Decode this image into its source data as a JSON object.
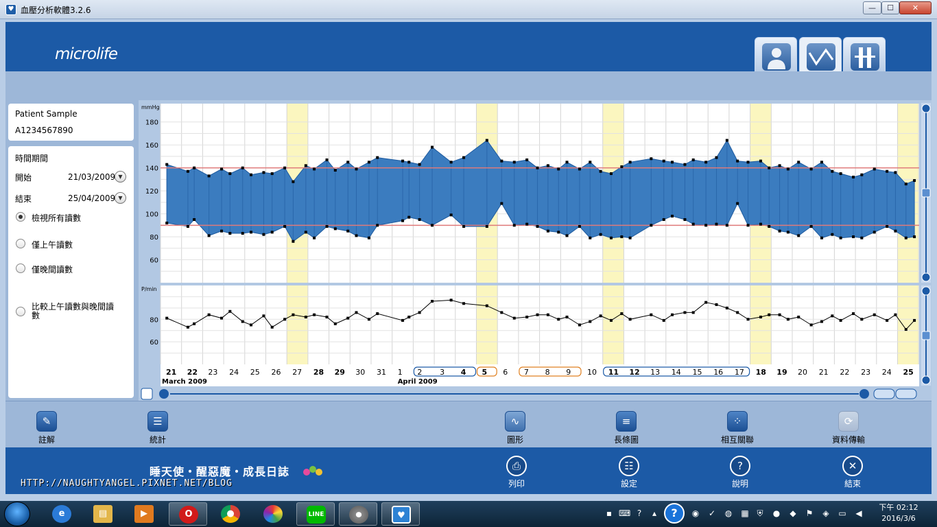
{
  "window": {
    "title": "血壓分析軟體3.2.6",
    "controls": {
      "minimize": "—",
      "maximize": "☐",
      "close": "✕"
    }
  },
  "brand": {
    "logo": "microlife"
  },
  "view_tabs": [
    {
      "label": "病患",
      "icon": "person-icon"
    },
    {
      "label": "圖形",
      "icon": "wave-chart-icon",
      "active": true
    },
    {
      "label": "表格",
      "icon": "table-icon"
    }
  ],
  "patient": {
    "name": "Patient Sample",
    "id": "A1234567890"
  },
  "period": {
    "title": "時間期間",
    "start_label": "開始",
    "start_value": "21/03/2009",
    "end_label": "結束",
    "end_value": "25/04/2009"
  },
  "filters": [
    {
      "label": "檢視所有讀數",
      "selected": true
    },
    {
      "label": "僅上午讀數",
      "selected": false
    },
    {
      "label": "僅晚間讀數",
      "selected": false
    },
    {
      "label": "比較上午讀數與晚間讀數",
      "selected": false
    }
  ],
  "chart_data": {
    "type": "area",
    "bp_unit": "mmHg",
    "bp_yticks": [
      60,
      80,
      100,
      120,
      140,
      160,
      180
    ],
    "bp_ylim": [
      40,
      190
    ],
    "thresholds": [
      140,
      90
    ],
    "pulse_unit": "P/min",
    "pulse_yticks": [
      60,
      80
    ],
    "pulse_ylim": [
      40,
      110
    ],
    "x_range": [
      0,
      36
    ],
    "x": [
      0.3,
      1.3,
      1.6,
      2.3,
      2.9,
      3.3,
      3.9,
      4.3,
      4.9,
      5.3,
      5.9,
      6.3,
      6.9,
      7.3,
      7.9,
      8.3,
      8.9,
      9.3,
      9.9,
      10.3,
      11.5,
      11.8,
      12.3,
      12.9,
      13.8,
      14.4,
      15.5,
      16.2,
      16.8,
      17.4,
      17.9,
      18.4,
      18.9,
      19.3,
      19.9,
      20.4,
      20.9,
      21.4,
      21.9,
      22.3,
      23.3,
      23.9,
      24.3,
      24.9,
      25.3,
      25.9,
      26.4,
      26.9,
      27.4,
      27.9,
      28.5,
      28.9,
      29.4,
      29.8,
      30.3,
      30.9,
      31.4,
      31.9,
      32.3,
      32.9,
      33.3,
      33.9,
      34.5,
      34.9,
      35.4,
      35.8
    ],
    "series": [
      {
        "name": "",
        "values": [
          143,
          137,
          140,
          133,
          139,
          135,
          140,
          134,
          136,
          135,
          140,
          128,
          142,
          139,
          147,
          138,
          145,
          139,
          145,
          149,
          146,
          145,
          143,
          158,
          145,
          149,
          164,
          146,
          145,
          147,
          140,
          142,
          139,
          145,
          139,
          145,
          137,
          135,
          141,
          145,
          148,
          146,
          145,
          143,
          147,
          145,
          149,
          164,
          146,
          145,
          146,
          140,
          142,
          139,
          145,
          139,
          145,
          137,
          135,
          132,
          134,
          139,
          137,
          136,
          126,
          129
        ]
      },
      {
        "name": "",
        "values": [
          92,
          89,
          95,
          81,
          85,
          83,
          83,
          84,
          82,
          84,
          89,
          76,
          84,
          79,
          89,
          87,
          85,
          81,
          79,
          90,
          94,
          97,
          95,
          90,
          99,
          89,
          89,
          109,
          90,
          91,
          89,
          85,
          84,
          81,
          89,
          79,
          82,
          79,
          80,
          79,
          90,
          95,
          98,
          95,
          91,
          90,
          91,
          90,
          109,
          90,
          91,
          89,
          85,
          84,
          81,
          89,
          79,
          82,
          79,
          80,
          79,
          84,
          89,
          85,
          79,
          80
        ]
      },
      {
        "name": "",
        "values": [
          81,
          73,
          76,
          84,
          81,
          87,
          78,
          75,
          83,
          73,
          80,
          84,
          82,
          84,
          82,
          76,
          81,
          86,
          80,
          85,
          79,
          82,
          86,
          96,
          97,
          94,
          92,
          86,
          81,
          82,
          84,
          84,
          80,
          82,
          75,
          78,
          83,
          79,
          85,
          80,
          84,
          79,
          84,
          86,
          86,
          95,
          93,
          90,
          86,
          80,
          82,
          84,
          84,
          80,
          82,
          75,
          78,
          83,
          79,
          85,
          80,
          84,
          79,
          84,
          71,
          79
        ]
      }
    ],
    "highlight_days": [
      27,
      5,
      11,
      18,
      25
    ],
    "day_labels": [
      {
        "text": "21",
        "bold": true
      },
      {
        "text": "22",
        "bold": true
      },
      {
        "text": "23",
        "bold": false
      },
      {
        "text": "24",
        "bold": false
      },
      {
        "text": "25",
        "bold": false
      },
      {
        "text": "26",
        "bold": false
      },
      {
        "text": "27",
        "bold": false
      },
      {
        "text": "28",
        "bold": true
      },
      {
        "text": "29",
        "bold": true
      },
      {
        "text": "30",
        "bold": false
      },
      {
        "text": "31",
        "bold": false
      },
      {
        "text": "1",
        "bold": false
      },
      {
        "text": "2",
        "bold": false
      },
      {
        "text": "3",
        "bold": false
      },
      {
        "text": "4",
        "bold": true
      },
      {
        "text": "5",
        "bold": true
      },
      {
        "text": "6",
        "bold": false
      },
      {
        "text": "7",
        "bold": false
      },
      {
        "text": "8",
        "bold": false
      },
      {
        "text": "9",
        "bold": false
      },
      {
        "text": "10",
        "bold": false
      },
      {
        "text": "11",
        "bold": true
      },
      {
        "text": "12",
        "bold": true
      },
      {
        "text": "13",
        "bold": false
      },
      {
        "text": "14",
        "bold": false
      },
      {
        "text": "15",
        "bold": false
      },
      {
        "text": "16",
        "bold": false
      },
      {
        "text": "17",
        "bold": false
      },
      {
        "text": "18",
        "bold": true
      },
      {
        "text": "19",
        "bold": true
      },
      {
        "text": "20",
        "bold": false
      },
      {
        "text": "21",
        "bold": false
      },
      {
        "text": "22",
        "bold": false
      },
      {
        "text": "23",
        "bold": false
      },
      {
        "text": "24",
        "bold": false
      },
      {
        "text": "25",
        "bold": true
      }
    ],
    "month_labels": [
      "March 2009",
      "April 2009"
    ],
    "day_groups": [
      {
        "from": 12,
        "to": 14,
        "color": "#1c5aa6"
      },
      {
        "from": 15,
        "to": 15,
        "color": "#e08020"
      },
      {
        "from": 17,
        "to": 19,
        "color": "#e08020"
      },
      {
        "from": 21,
        "to": 27,
        "color": "#1c5aa6"
      }
    ],
    "colors": {
      "band": "#3b7cbf",
      "band_edge": "#1e5a9e",
      "threshold": "#e07a7a",
      "highlight": "#fbf6bf",
      "point": "#000000"
    }
  },
  "toolbar": [
    {
      "label": "註解",
      "icon": "pencil-icon"
    },
    {
      "label": "統計",
      "icon": "statistics-icon"
    },
    {
      "label": "圖形",
      "icon": "line-graph-icon"
    },
    {
      "label": "長條圖",
      "icon": "bar-chart-icon"
    },
    {
      "label": "相互關聯",
      "icon": "correlation-icon"
    },
    {
      "label": "資料傳輸",
      "icon": "data-transfer-icon"
    }
  ],
  "footer": [
    {
      "label": "列印",
      "icon": "print-icon"
    },
    {
      "label": "設定",
      "icon": "settings-icon"
    },
    {
      "label": "說明",
      "icon": "help-icon"
    },
    {
      "label": "結束",
      "icon": "exit-icon"
    }
  ],
  "watermark": {
    "line1": "睡天使・醒惡魔・成長日誌",
    "line2": "HTTP://NAUGHTYANGEL.PIXNET.NET/BLOG"
  },
  "taskbar": {
    "apps": [
      "ie-icon",
      "file-explorer-icon",
      "media-player-icon",
      "opera-icon",
      "chrome-icon",
      "picasa-icon",
      "line-icon",
      "color-app-icon",
      "microlife-app-icon"
    ],
    "clock_time": "下午 02:12",
    "clock_date": "2016/3/6"
  }
}
